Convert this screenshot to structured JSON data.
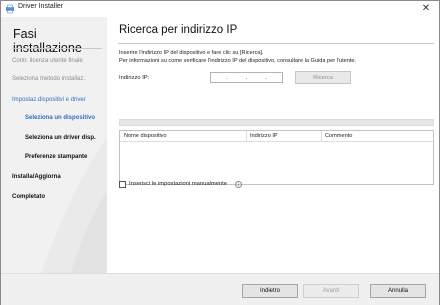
{
  "window": {
    "title": "Driver Installer",
    "app_icon": "printer-icon",
    "close_icon": "close-icon",
    "close_glyph": "✕"
  },
  "sidebar": {
    "title": "Fasi installazione",
    "steps": [
      {
        "label": "Contr. licenza utente finale",
        "state": "done"
      },
      {
        "label": "Seleziona metodo installaz.",
        "state": "done"
      },
      {
        "label": "Impostaz.dispositivi e driver",
        "state": "current"
      },
      {
        "label": "Seleziona un dispositivo",
        "state": "sub-current"
      },
      {
        "label": "Seleziona un driver disp.",
        "state": "pending"
      },
      {
        "label": "Preferenze stampante",
        "state": "pending"
      },
      {
        "label": "Installa/Aggiorna",
        "state": "pending"
      },
      {
        "label": "Completato",
        "state": "pending"
      }
    ]
  },
  "main": {
    "title": "Ricerca per indirizzo IP",
    "instructions": [
      "Inserire l'indirizzo IP del dispositivo e fare clic su [Ricerca].",
      "Per informazioni su come verificare l'indirizzo IP del dispositivo, consultare la Guida per l'utente."
    ],
    "ip_label": "Indirizzo IP:",
    "ip_dots": [
      ".",
      ".",
      "."
    ],
    "search_button": "Ricerca",
    "table": {
      "columns": [
        "Nome dispositivo",
        "Indirizzo IP",
        "Commento"
      ],
      "rows": []
    },
    "manual_checkbox": {
      "label": "Inserisci le impostazioni manualmente",
      "checked": false
    },
    "info_glyph": "i"
  },
  "footer": {
    "back_button": "Indietro",
    "next_button": "Avanti",
    "cancel_button": "Annulla"
  },
  "colors": {
    "accent": "#2f6fbf",
    "sidebar_bg": "#f1f1f1",
    "footer_bg": "#f0f0f0"
  }
}
